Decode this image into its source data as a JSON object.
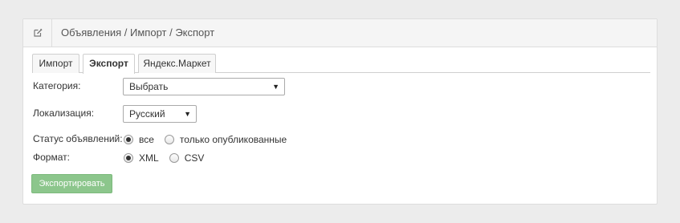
{
  "header": {
    "title": "Объявления / Импорт / Экспорт",
    "icon": "edit-icon"
  },
  "tabs": [
    {
      "label": "Импорт",
      "active": false
    },
    {
      "label": "Экспорт",
      "active": true
    },
    {
      "label": "Яндекс.Маркет",
      "active": false
    }
  ],
  "form": {
    "category": {
      "label": "Категория:",
      "value": "Выбрать"
    },
    "locale": {
      "label": "Локализация:",
      "value": "Русский"
    },
    "status": {
      "label": "Статус объявлений:",
      "options": [
        {
          "label": "все",
          "checked": true
        },
        {
          "label": "только опубликованные",
          "checked": false
        }
      ]
    },
    "format": {
      "label": "Формат:",
      "options": [
        {
          "label": "XML",
          "checked": true
        },
        {
          "label": "CSV",
          "checked": false
        }
      ]
    },
    "submit_label": "Экспортировать"
  },
  "colors": {
    "button": "#8cc68c",
    "header_bg": "#f5f5f5",
    "page_bg": "#ececec"
  }
}
